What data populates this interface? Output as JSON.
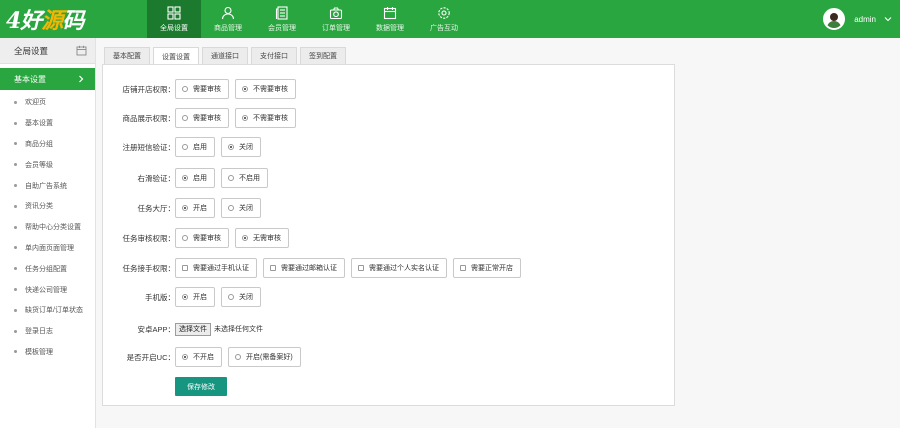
{
  "logo": {
    "part1": "4好",
    "part2": "源",
    "part3": "码"
  },
  "nav": [
    {
      "label": "全局设置",
      "icon": "grid-icon",
      "active": true
    },
    {
      "label": "商品管理",
      "icon": "user-icon",
      "active": false
    },
    {
      "label": "会员管理",
      "icon": "document-icon",
      "active": false
    },
    {
      "label": "订单管理",
      "icon": "camera-icon",
      "active": false
    },
    {
      "label": "数据管理",
      "icon": "calendar-icon",
      "active": false
    },
    {
      "label": "广告互动",
      "icon": "gear-icon",
      "active": false
    }
  ],
  "user": {
    "name": "admin"
  },
  "sidebar": {
    "title": "全局设置",
    "active_item": "基本设置",
    "items": [
      "欢迎页",
      "基本设置",
      "商品分组",
      "会员等级",
      "自助广告系统",
      "资讯分类",
      "帮助中心分类设置",
      "单内面页面管理",
      "任务分组配置",
      "快递公司管理",
      "缺货订单/订单状态",
      "登录日志",
      "模板管理"
    ]
  },
  "tabs": [
    "基本配置",
    "设置设置",
    "通道接口",
    "支付接口",
    "签到配置"
  ],
  "active_tab_index": 1,
  "form": {
    "rows": [
      {
        "label": "店铺开店权限：",
        "type": "radio",
        "options": [
          "需要审核",
          "不需要审核"
        ],
        "selected": 1
      },
      {
        "label": "商品展示权限：",
        "type": "radio",
        "options": [
          "需要审核",
          "不需要审核"
        ],
        "selected": 1
      },
      {
        "label": "注册短信验证：",
        "type": "radio",
        "options": [
          "启用",
          "关闭"
        ],
        "selected": 1
      },
      {
        "label": "右滑验证：",
        "type": "radio",
        "options": [
          "启用",
          "不启用"
        ],
        "selected": 0
      },
      {
        "label": "任务大厅：",
        "type": "radio",
        "options": [
          "开启",
          "关闭"
        ],
        "selected": 0
      },
      {
        "label": "任务审核权限：",
        "type": "radio",
        "options": [
          "需要审核",
          "无需审核"
        ],
        "selected": 1
      },
      {
        "label": "任务接手权限：",
        "type": "checkbox",
        "options": [
          "需要通过手机认证",
          "需要通过邮箱认证",
          "需要通过个人实名认证",
          "需要正常开店"
        ]
      },
      {
        "label": "手机版：",
        "type": "radio",
        "options": [
          "开启",
          "关闭"
        ],
        "selected": 0
      },
      {
        "label": "安卓APP：",
        "type": "file",
        "button": "选择文件",
        "status": "未选择任何文件"
      },
      {
        "label": "是否开启UC：",
        "type": "radio",
        "options": [
          "不开启",
          "开启(需备案好)"
        ],
        "selected": 0
      }
    ],
    "save_label": "保存修改"
  },
  "colors": {
    "primary": "#2aa640",
    "nav_active": "#1b7a2d",
    "save_button": "#169681"
  }
}
